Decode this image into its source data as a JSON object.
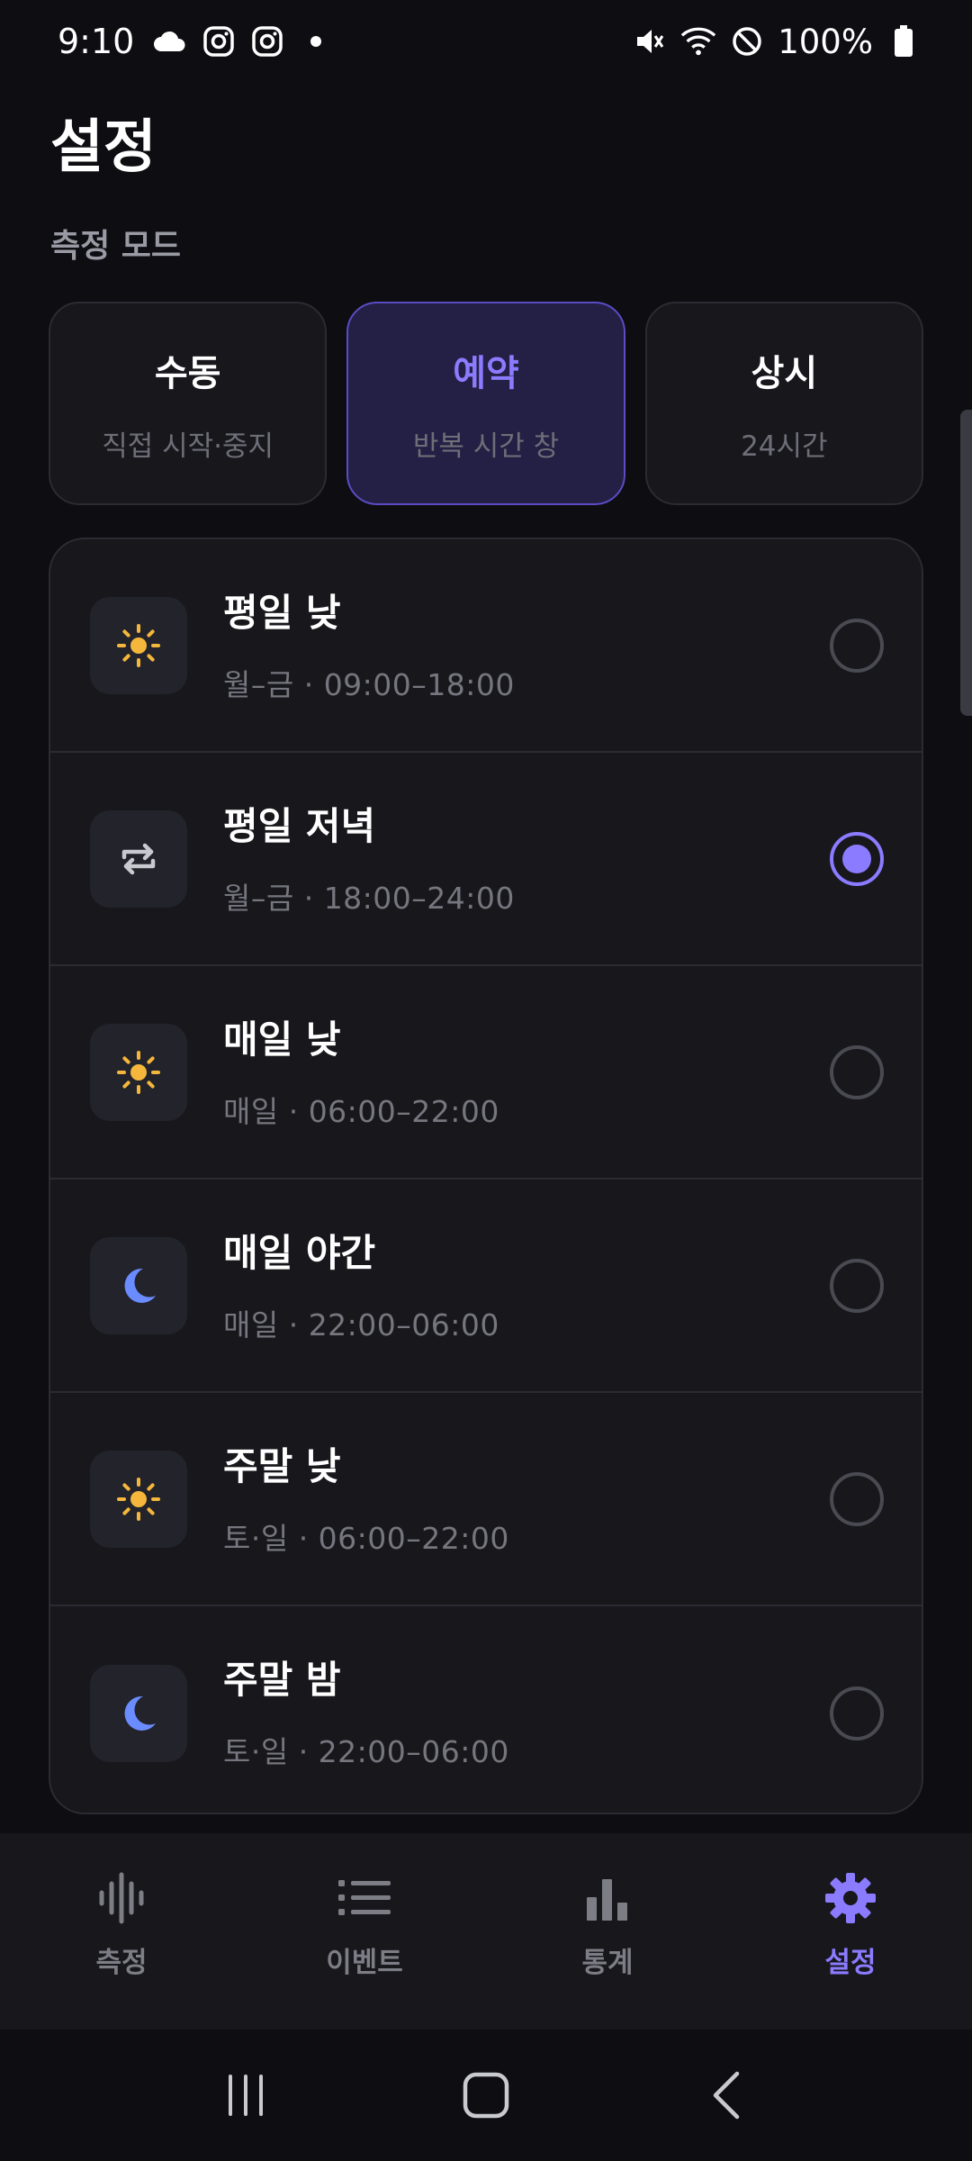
{
  "status_bar": {
    "time": "9:10",
    "battery": "100%"
  },
  "page_title": "설정",
  "section_label": "측정 모드",
  "modes": [
    {
      "title": "수동",
      "subtitle": "직접 시작·중지",
      "active": false
    },
    {
      "title": "예약",
      "subtitle": "반복 시간 창",
      "active": true
    },
    {
      "title": "상시",
      "subtitle": "24시간",
      "active": false
    }
  ],
  "schedules": [
    {
      "title": "평일 낮",
      "subtitle": "월–금 · 09:00–18:00",
      "icon": "sun-icon",
      "selected": false
    },
    {
      "title": "평일 저녁",
      "subtitle": "월–금 · 18:00–24:00",
      "icon": "repeat-icon",
      "selected": true
    },
    {
      "title": "매일 낮",
      "subtitle": "매일 · 06:00–22:00",
      "icon": "sun-icon",
      "selected": false
    },
    {
      "title": "매일 야간",
      "subtitle": "매일 · 22:00–06:00",
      "icon": "moon-icon",
      "selected": false
    },
    {
      "title": "주말 낮",
      "subtitle": "토·일 · 06:00–22:00",
      "icon": "sun-icon",
      "selected": false
    },
    {
      "title": "주말 밤",
      "subtitle": "토·일 · 22:00–06:00",
      "icon": "moon-icon",
      "selected": false
    }
  ],
  "bottom_nav": [
    {
      "label": "측정",
      "icon": "waveform-icon",
      "active": false
    },
    {
      "label": "이벤트",
      "icon": "list-icon",
      "active": false
    },
    {
      "label": "통계",
      "icon": "bar-chart-icon",
      "active": false
    },
    {
      "label": "설정",
      "icon": "gear-icon",
      "active": true
    }
  ],
  "colors": {
    "accent": "#8b7bff",
    "sun": "#f5b73b",
    "moon": "#6b8cff",
    "background": "#0d0d12",
    "card": "#17171c"
  }
}
